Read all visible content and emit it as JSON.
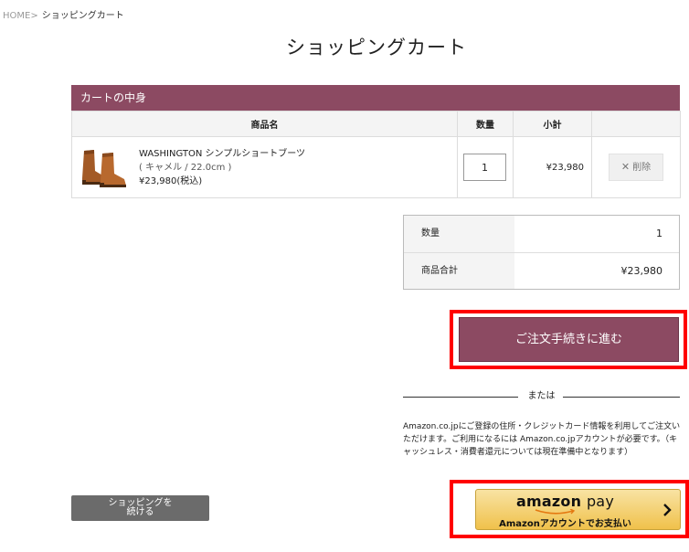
{
  "breadcrumb": {
    "home": "HOME",
    "separator": ">",
    "current": "ショッピングカート"
  },
  "page_title": "ショッピングカート",
  "cart": {
    "heading": "カートの中身",
    "columns": [
      "商品名",
      "数量",
      "小計",
      ""
    ],
    "items": [
      {
        "name": "WASHINGTON シンプルショートブーツ",
        "variant": "( キャメル / 22.0cm )",
        "price": "¥23,980(税込)",
        "quantity": "1",
        "subtotal": "¥23,980",
        "delete_label": "削除",
        "image_icon": "boots-product-image"
      }
    ]
  },
  "summary": {
    "quantity_label": "数量",
    "quantity_value": "1",
    "total_label": "商品合計",
    "total_value": "¥23,980"
  },
  "order_button_label": "ご注文手続きに進む",
  "or_label": "または",
  "amazon_note": "Amazon.co.jpにご登録の住所・クレジットカード情報を利用してご注文いただけます。ご利用になるには Amazon.co.jpアカウントが必要です。（キャッシュレス・消費者還元については現在準備中となります）",
  "amazon_pay": {
    "logo_amazon": "amazon",
    "logo_pay": "pay",
    "sub_label": "Amazonアカウントでお支払い"
  },
  "continue_button": {
    "line1": "ショッピングを",
    "line2": "続ける"
  },
  "colors": {
    "accent": "#8c4a62",
    "highlight": "#ff0000",
    "amazon_gold": "#f0c14b"
  }
}
